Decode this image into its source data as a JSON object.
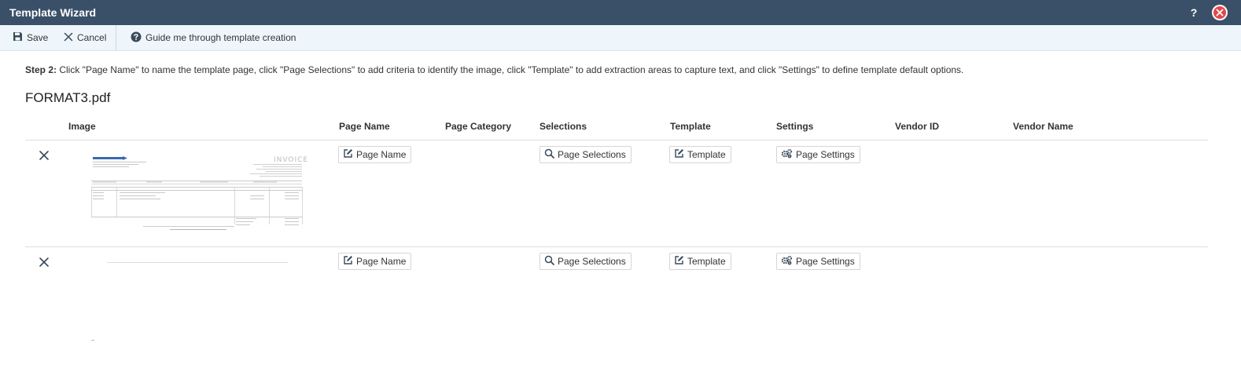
{
  "window": {
    "title": "Template Wizard",
    "help_label": "?",
    "accent_color": "#3a5068",
    "close_color": "#e2474b"
  },
  "toolbar": {
    "save_label": "Save",
    "cancel_label": "Cancel",
    "guide_label": "Guide me through template creation",
    "icons": [
      "save-icon",
      "close-icon",
      "question-circle-icon"
    ]
  },
  "instructions": {
    "step_label": "Step 2:",
    "text": " Click \"Page Name\" to name the template page, click \"Page Selections\" to add criteria to identify the image, click \"Template\" to add extraction areas to capture text, and click \"Settings\" to define template default options."
  },
  "file": {
    "name": "FORMAT3.pdf"
  },
  "table": {
    "columns": [
      "Image",
      "Page Name",
      "Page Category",
      "Selections",
      "Template",
      "Settings",
      "Vendor ID",
      "Vendor Name"
    ],
    "rows": [
      {
        "delete_icon": "close-icon",
        "thumbnail_heading": "INVOICE",
        "page_name_button": "Page Name",
        "page_category": "",
        "selections_button": "Page Selections",
        "template_button": "Template",
        "settings_button": "Page Settings",
        "vendor_id": "",
        "vendor_name": ""
      },
      {
        "delete_icon": "close-icon",
        "page_name_button": "Page Name",
        "page_category": "",
        "selections_button": "Page Selections",
        "template_button": "Template",
        "settings_button": "Page Settings",
        "vendor_id": "",
        "vendor_name": ""
      }
    ]
  }
}
